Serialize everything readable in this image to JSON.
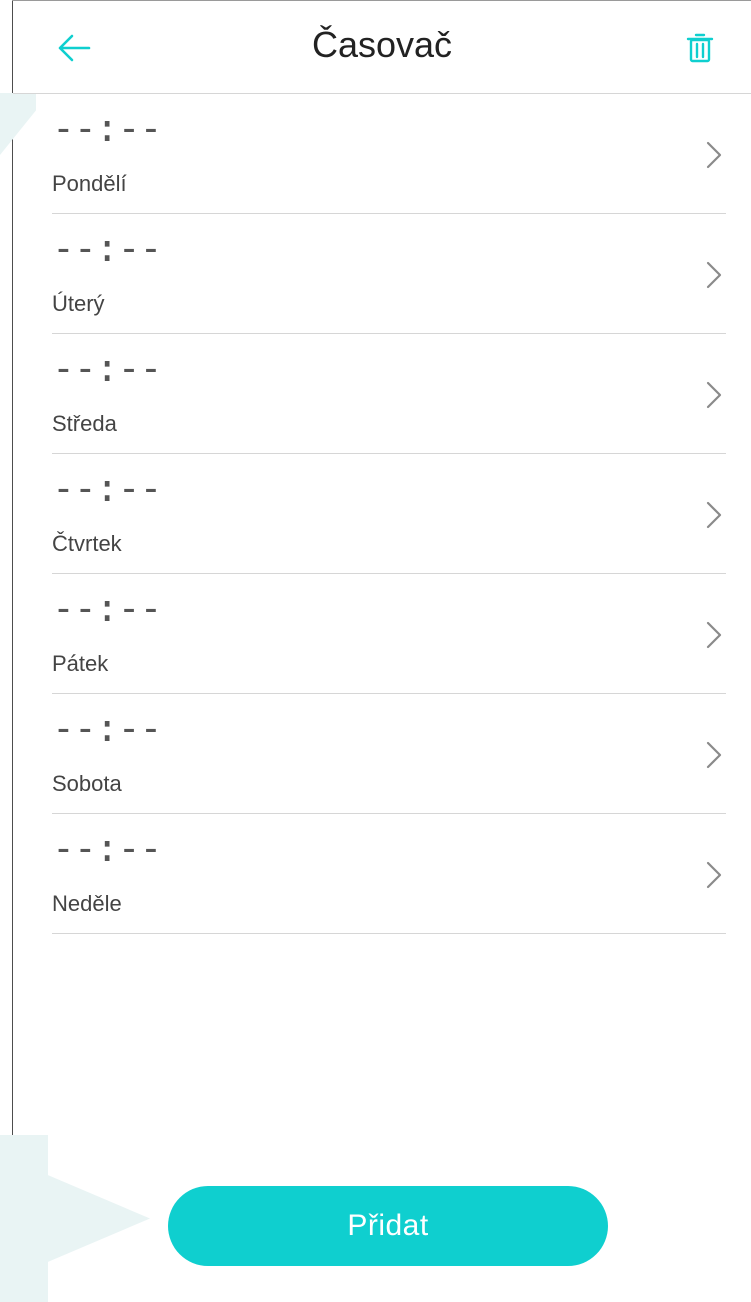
{
  "colors": {
    "accent": "#0fcfcf",
    "background": "#ffffff",
    "divider": "#d6d6d6"
  },
  "header": {
    "title": "Časovač",
    "back_icon": "arrow-left-icon",
    "delete_icon": "trash-icon"
  },
  "schedule": {
    "days": [
      {
        "time": "--:--",
        "day": "Pondělí"
      },
      {
        "time": "--:--",
        "day": "Úterý"
      },
      {
        "time": "--:--",
        "day": "Středa"
      },
      {
        "time": "--:--",
        "day": "Čtvrtek"
      },
      {
        "time": "--:--",
        "day": "Pátek"
      },
      {
        "time": "--:--",
        "day": "Sobota"
      },
      {
        "time": "--:--",
        "day": "Neděle"
      }
    ]
  },
  "footer": {
    "add_label": "Přidat"
  }
}
